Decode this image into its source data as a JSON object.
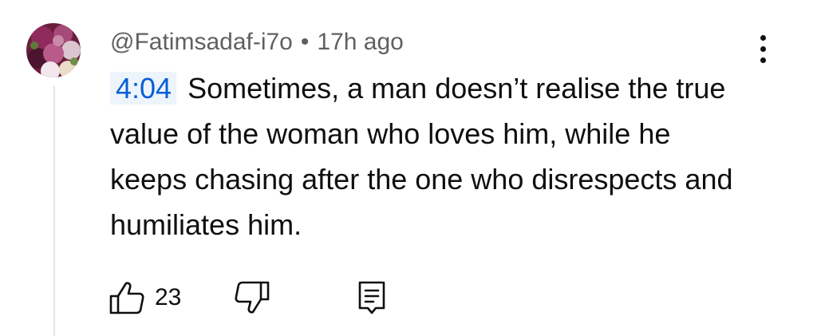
{
  "comment": {
    "author": "@Fatimsadaf-i7o",
    "separator": "•",
    "time_ago": "17h ago",
    "timestamp_link": "4:04",
    "text": "Sometimes, a man doesn’t realise the true value of the woman who loves him, while he keeps chasing after the one who disrespects and humiliates him.",
    "like_count": "23"
  },
  "icons": {
    "like": "thumbs-up-icon",
    "dislike": "thumbs-down-icon",
    "reply": "comment-reply-icon",
    "menu": "more-vertical-icon"
  },
  "colors": {
    "text": "#0f0f0f",
    "secondary_text": "#606060",
    "timestamp_link": "#065fd4",
    "timestamp_bg": "#eef4fc",
    "thread_line": "#e3e3e3"
  }
}
